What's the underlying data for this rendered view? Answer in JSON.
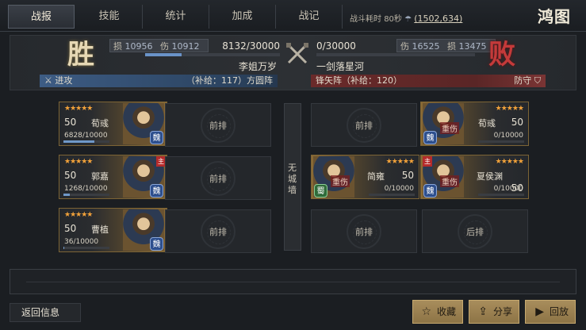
{
  "tabs": [
    {
      "label": "战报",
      "active": true
    },
    {
      "label": "技能",
      "active": false
    },
    {
      "label": "统计",
      "active": false
    },
    {
      "label": "加成",
      "active": false
    },
    {
      "label": "战记",
      "active": false
    }
  ],
  "battle_info": {
    "duration_label": "战斗耗时",
    "duration": "80秒",
    "coord": "(1502,634)"
  },
  "logo": "鸿图",
  "header": {
    "win_char": "胜",
    "lose_char": "败",
    "left": {
      "loss_label": "损",
      "loss": "10956",
      "injury_label": "伤",
      "injury": "10912",
      "hp": "8132/30000",
      "player": "李姐万岁",
      "hp_fraction": 0.27
    },
    "right": {
      "loss_label": "损",
      "loss": "13475",
      "injury_label": "伤",
      "injury": "16525",
      "hp": "0/30000",
      "player": "一剑落星河",
      "hp_fraction": 0
    }
  },
  "formation": {
    "left": {
      "stance": "进攻",
      "supply": "（补给：117）方圆阵"
    },
    "right": {
      "supply": "锋矢阵（补给：120）",
      "stance": "防守"
    }
  },
  "wall_label": "无城墙",
  "attackers": [
    {
      "stars": "★★★★★",
      "level": "50",
      "name": "荀彧",
      "troops": "6828/10000",
      "troop_fraction": 0.68,
      "faction": "魏",
      "lord": false
    },
    {
      "stars": "★★★★★",
      "level": "50",
      "name": "郭嘉",
      "troops": "1268/10000",
      "troop_fraction": 0.13,
      "faction": "魏",
      "lord": true
    },
    {
      "stars": "★★★★★",
      "level": "50",
      "name": "曹植",
      "troops": "36/10000",
      "troop_fraction": 0.004,
      "faction": "魏",
      "lord": false
    }
  ],
  "attacker_front_label": "前排",
  "defenders": [
    {
      "stars": "★★★★★",
      "level": "50",
      "name": "荀彧",
      "troops": "0/10000",
      "faction": "魏",
      "status": "重伤",
      "lord": false
    },
    {
      "stars": "★★★★★",
      "level": "50",
      "name": "夏侯渊",
      "troops": "0/10000",
      "faction": "魏",
      "status": "重伤",
      "lord": true
    },
    {
      "stars": "★★★★★",
      "level": "50",
      "name": "简雍",
      "troops": "0/10000",
      "faction": "蜀",
      "status": "重伤",
      "lord": false
    }
  ],
  "defender_labels": {
    "front": "前排",
    "back": "后排"
  },
  "bottom": {
    "back_info": "返回信息",
    "favorite": "收藏",
    "share": "分享",
    "replay": "回放"
  },
  "colors": {
    "win": "#e6d8b4",
    "lose": "#c43a3a",
    "star": "#f2a23a",
    "button": "#a88d5c"
  }
}
